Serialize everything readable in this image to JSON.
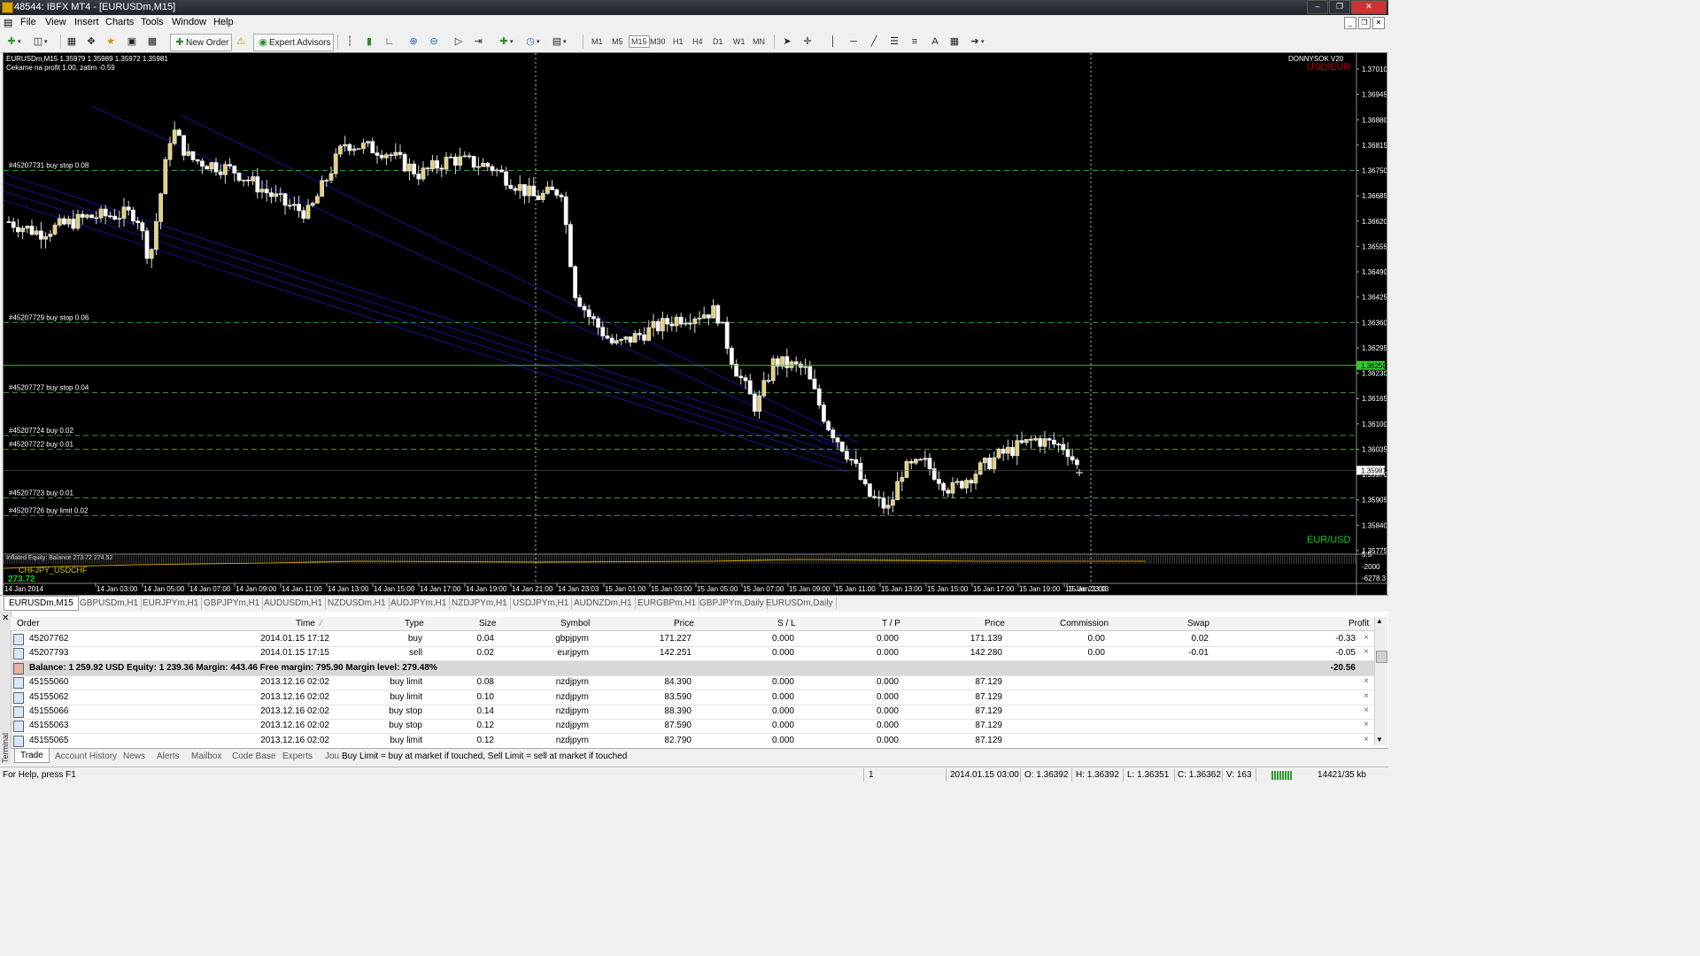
{
  "window": {
    "title": "48544: IBFX MT4 - [EURUSDm,M15]"
  },
  "menu": [
    "File",
    "View",
    "Insert",
    "Charts",
    "Tools",
    "Window",
    "Help"
  ],
  "toolbar": {
    "new_order": "New Order",
    "expert_advisors": "Expert Advisors",
    "timeframes": [
      "M1",
      "M5",
      "M15",
      "M30",
      "H1",
      "H4",
      "D1",
      "W1",
      "MN"
    ]
  },
  "chart": {
    "header": "EURUSDm,M15  1.35979 1.35989 1.35972 1.35981",
    "comment": "Cekame na profit 1.00, zatim -0.59",
    "brand": "DONNYSOK V20",
    "pair_label_top": "USD/EUR",
    "pair_label_bottom": "EUR/USD",
    "indicator_text": "Inflated Equity: Balance  273.72  274.52",
    "indicator_pair": "CHFJPY_USDCHF",
    "indicator_value": "273.72",
    "current_price": "1.36250",
    "bid_price": "1.35981",
    "price_axis": [
      "1.37010",
      "1.36945",
      "1.36880",
      "1.36815",
      "1.36750",
      "1.36685",
      "1.36620",
      "1.36555",
      "1.36490",
      "1.36425",
      "1.36360",
      "1.36295",
      "1.36230",
      "1.36165",
      "1.36100",
      "1.36035",
      "1.35970",
      "1.35905",
      "1.35840",
      "1.35775"
    ],
    "indicator_axis": [
      "5.5",
      "-2000",
      "-6278.3"
    ],
    "time_axis": [
      "14 Jan 2014",
      "14 Jan 03:00",
      "14 Jan 05:00",
      "14 Jan 07:00",
      "14 Jan 09:00",
      "14 Jan 11:00",
      "14 Jan 13:00",
      "14 Jan 15:00",
      "14 Jan 17:00",
      "14 Jan 19:00",
      "14 Jan 21:00",
      "14 Jan 23:03",
      "15 Jan 01:00",
      "15 Jan 03:00",
      "15 Jan 05:00",
      "15 Jan 07:00",
      "15 Jan 09:00",
      "15 Jan 11:00",
      "15 Jan 13:00",
      "15 Jan 15:00",
      "15 Jan 17:00",
      "15 Jan 19:00",
      "15 Jan 21:00",
      "15 Jan 23:03"
    ],
    "order_lines": [
      {
        "label": "#45207731 buy stop 0.08",
        "price": 1.3675
      },
      {
        "label": "#45207729 buy stop 0.06",
        "price": 1.3636
      },
      {
        "label": "#45207727 buy stop 0.04",
        "price": 1.3618
      },
      {
        "label": "#45207724 buy 0.02",
        "price": 1.3607
      },
      {
        "label": "#45207722 buy 0.01",
        "price": 1.36035
      },
      {
        "label": "#45207723 buy 0.01",
        "price": 1.3591
      },
      {
        "label": "#45207726 buy limit 0.02",
        "price": 1.35865
      }
    ]
  },
  "chart_tabs": [
    "EURUSDm,M15",
    "GBPUSDm,H1",
    "EURJPYm,H1",
    "GBPJPYm,H1",
    "AUDUSDm,H1",
    "NZDUSDm,H1",
    "AUDJPYm,H1",
    "NZDJPYm,H1",
    "USDJPYm,H1",
    "AUDNZDm,H1",
    "EURGBPm,H1",
    "GBPJPYm,Daily",
    "EURUSDm,Daily"
  ],
  "terminal": {
    "side_label": "Terminal",
    "columns": [
      "Order",
      "Time",
      "Type",
      "Size",
      "Symbol",
      "Price",
      "S / L",
      "T / P",
      "Price",
      "Commission",
      "Swap",
      "Profit"
    ],
    "rows": [
      {
        "order": "45207762",
        "time": "2014.01.15 17:12",
        "type": "buy",
        "size": "0.04",
        "symbol": "gbpjpym",
        "price": "171.227",
        "sl": "0.000",
        "tp": "0.000",
        "cur": "171.139",
        "commission": "0.00",
        "swap": "0.02",
        "profit": "-0.33"
      },
      {
        "order": "45207793",
        "time": "2014.01.15 17:15",
        "type": "sell",
        "size": "0.02",
        "symbol": "eurjpym",
        "price": "142.251",
        "sl": "0.000",
        "tp": "0.000",
        "cur": "142.280",
        "commission": "0.00",
        "swap": "-0.01",
        "profit": "-0.05"
      }
    ],
    "balance_text": "Balance: 1 259.92 USD  Equity: 1 239.36  Margin: 443.46  Free margin: 795.90  Margin level: 279.48%",
    "balance_profit": "-20.56",
    "pending": [
      {
        "order": "45155060",
        "time": "2013.12.16 02:02",
        "type": "buy limit",
        "size": "0.08",
        "symbol": "nzdjpym",
        "price": "84.390",
        "sl": "0.000",
        "tp": "0.000",
        "cur": "87.129"
      },
      {
        "order": "45155062",
        "time": "2013.12.16 02:02",
        "type": "buy limit",
        "size": "0.10",
        "symbol": "nzdjpym",
        "price": "83.590",
        "sl": "0.000",
        "tp": "0.000",
        "cur": "87.129"
      },
      {
        "order": "45155066",
        "time": "2013.12.16 02:02",
        "type": "buy stop",
        "size": "0.14",
        "symbol": "nzdjpym",
        "price": "88.390",
        "sl": "0.000",
        "tp": "0.000",
        "cur": "87.129"
      },
      {
        "order": "45155063",
        "time": "2013.12.16 02:02",
        "type": "buy stop",
        "size": "0.12",
        "symbol": "nzdjpym",
        "price": "87.590",
        "sl": "0.000",
        "tp": "0.000",
        "cur": "87.129"
      },
      {
        "order": "45155065",
        "time": "2013.12.16 02:02",
        "type": "buy limit",
        "size": "0.12",
        "symbol": "nzdjpym",
        "price": "82.790",
        "sl": "0.000",
        "tp": "0.000",
        "cur": "87.129"
      }
    ],
    "tabs": [
      "Trade",
      "Account History",
      "News",
      "Alerts",
      "Mailbox",
      "Code Base",
      "Experts",
      "Jou"
    ],
    "journal_note": "Buy Limit = buy at market if touched, Sell Limit = sell at market if touched"
  },
  "status": {
    "help": "For Help, press F1",
    "profile": "1",
    "datetime": "2014.01.15 03:00",
    "open": "O: 1.36392",
    "high": "H: 1.36392",
    "low": "L: 1.36351",
    "close": "C: 1.36362",
    "volume": "V: 163",
    "traffic": "14421/35 kb"
  }
}
